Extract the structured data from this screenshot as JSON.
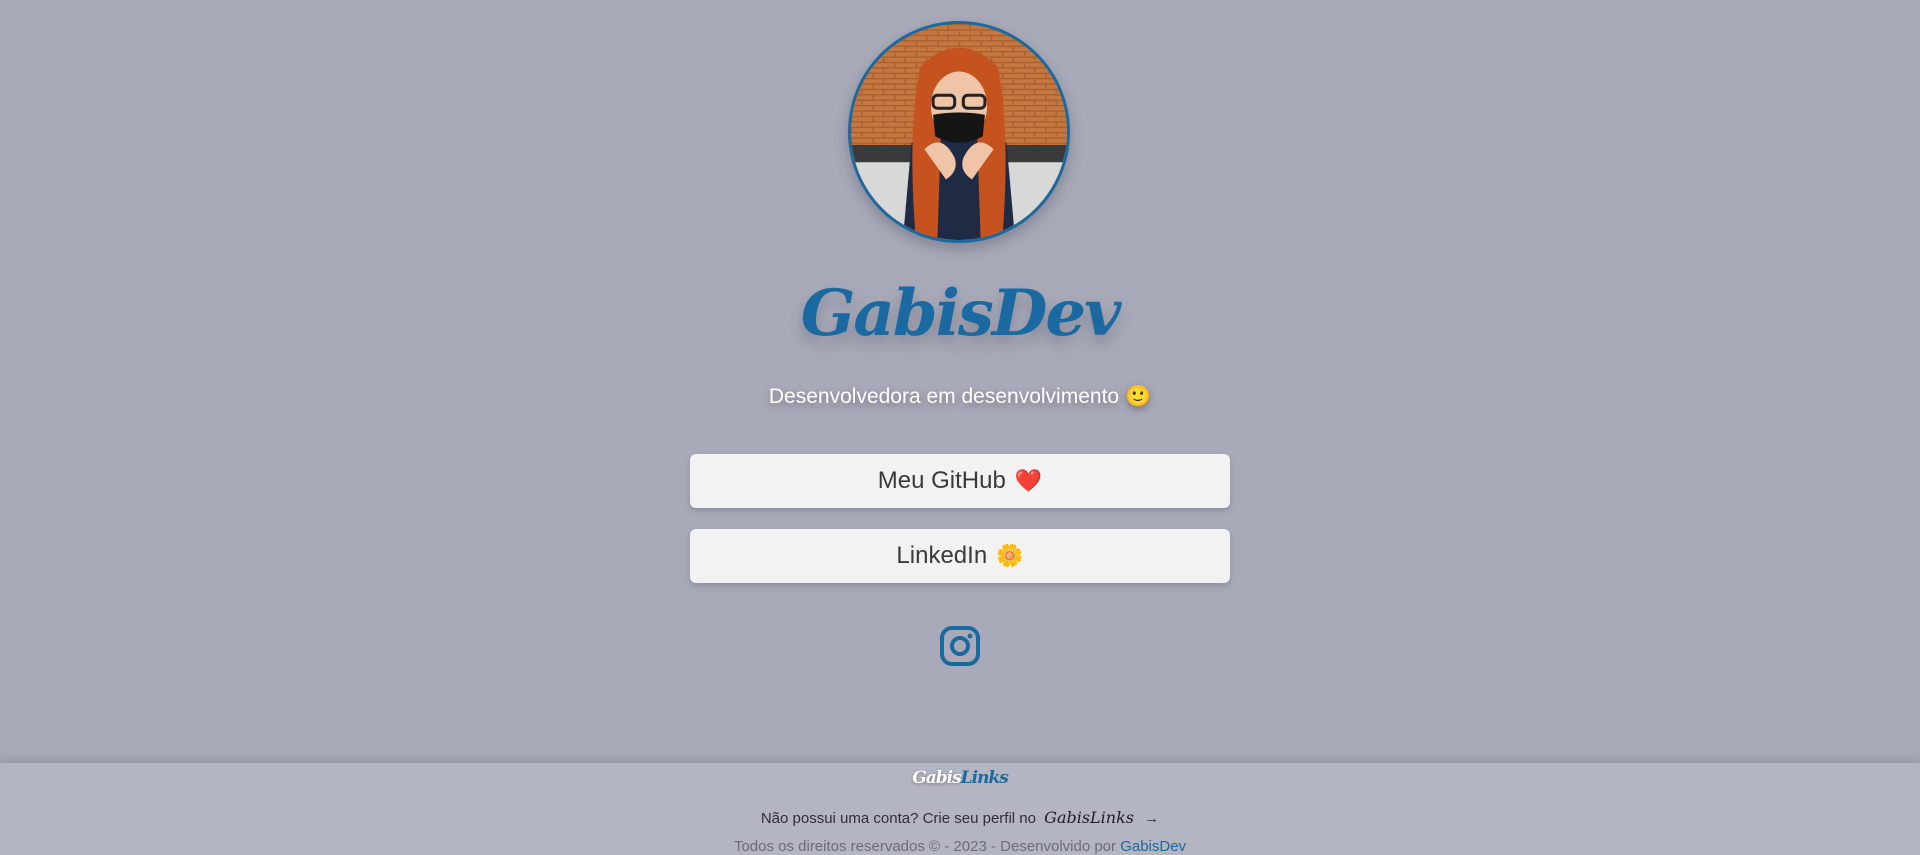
{
  "profile": {
    "title": "GabisDev",
    "subtitle": "Desenvolvedora em desenvolvimento",
    "subtitle_emoji": "🙂"
  },
  "links": [
    {
      "label": "Meu GitHub",
      "emoji": "❤️"
    },
    {
      "label": "LinkedIn",
      "emoji": "🌼"
    }
  ],
  "social": {
    "instagram_icon": "instagram-icon"
  },
  "footer": {
    "logo_part1": "Gabis",
    "logo_part2": "Links",
    "cta_text": "Não possui uma conta? Crie seu perfil no",
    "cta_brand": "GabisLinks",
    "cta_arrow": "→",
    "copyright": "Todos os direitos reservados © - 2023 - Desenvolvido por",
    "copyright_author": "GabisDev"
  },
  "colors": {
    "background": "#a8aab9",
    "accent": "#1a6aa1",
    "button_bg": "#f2f2f2",
    "footer_bg": "#b4b5c2"
  }
}
